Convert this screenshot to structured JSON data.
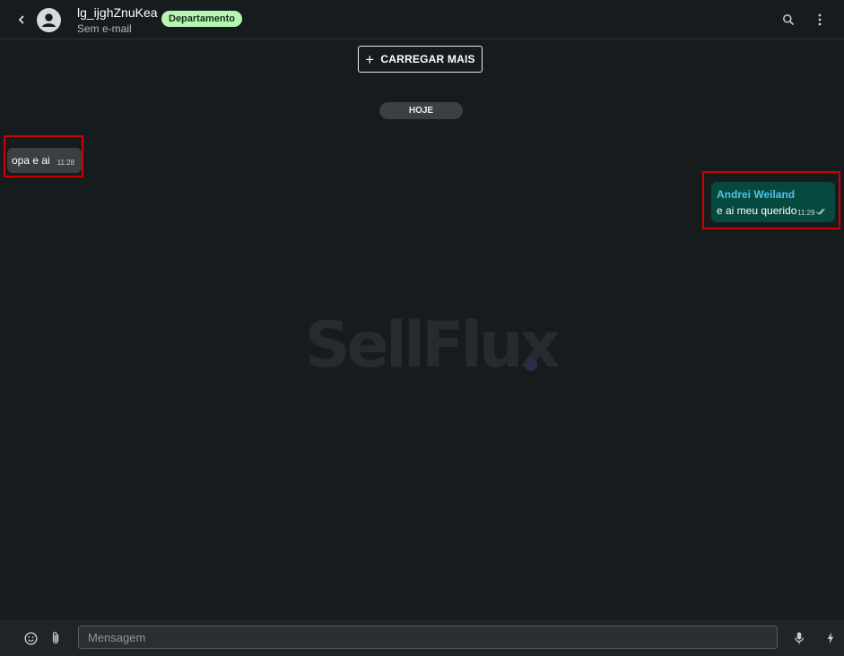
{
  "header": {
    "contact_name": "lg_ijghZnuKea",
    "contact_sub": "Sem e-mail",
    "badge": "Departamento",
    "icons": [
      "chevron-left-icon",
      "avatar-icon",
      "search-icon",
      "more-vert-icon"
    ]
  },
  "chat": {
    "load_more_label": "CARREGAR MAIS",
    "date_chip": "HOJE",
    "incoming": {
      "text": "opa e ai",
      "time": "11:28"
    },
    "outgoing": {
      "sender": "Andrei Weiland",
      "text": "e ai meu querido",
      "time": "11:29",
      "status": "read"
    },
    "watermark": "SellFlux"
  },
  "footer": {
    "placeholder": "Mensagem",
    "icons": [
      "emoji-icon",
      "attach-icon",
      "mic-icon",
      "bolt-icon"
    ]
  },
  "colors": {
    "background": "#161b1e",
    "incoming_bubble": "#3b3f42",
    "outgoing_bubble": "#06493f",
    "sender_name": "#4fc3e8",
    "badge": "#b7f5b3",
    "highlight": "#d10000"
  }
}
